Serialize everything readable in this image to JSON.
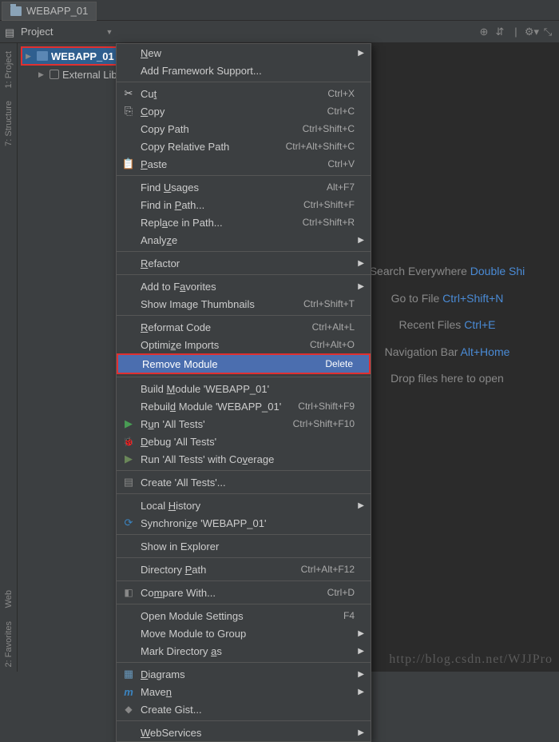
{
  "tab": {
    "title": "WEBAPP_01"
  },
  "toolbar": {
    "project_label": "Project"
  },
  "tree": {
    "module": "WEBAPP_01",
    "external": "External Librar"
  },
  "sidebar": {
    "project": "1: Project",
    "structure": "7: Structure",
    "web": "Web",
    "favorites": "2: Favorites"
  },
  "welcome": {
    "search_label": "Search Everywhere",
    "search_short": "Double Shi",
    "goto_label": "Go to File",
    "goto_short": "Ctrl+Shift+N",
    "recent_label": "Recent Files",
    "recent_short": "Ctrl+E",
    "nav_label": "Navigation Bar",
    "nav_short": "Alt+Home",
    "drop": "Drop files here to open"
  },
  "menu": {
    "new": "New",
    "add_framework": "Add Framework Support...",
    "cut": "Cut",
    "cut_s": "Ctrl+X",
    "copy": "Copy",
    "copy_s": "Ctrl+C",
    "copy_path": "Copy Path",
    "copy_path_s": "Ctrl+Shift+C",
    "copy_rel": "Copy Relative Path",
    "copy_rel_s": "Ctrl+Alt+Shift+C",
    "paste": "Paste",
    "paste_s": "Ctrl+V",
    "find_usages": "Find Usages",
    "find_usages_s": "Alt+F7",
    "find_in_path": "Find in Path...",
    "find_in_path_s": "Ctrl+Shift+F",
    "replace": "Replace in Path...",
    "replace_s": "Ctrl+Shift+R",
    "analyze": "Analyze",
    "refactor": "Refactor",
    "add_fav": "Add to Favorites",
    "show_thumb": "Show Image Thumbnails",
    "show_thumb_s": "Ctrl+Shift+T",
    "reformat": "Reformat Code",
    "reformat_s": "Ctrl+Alt+L",
    "optimize": "Optimize Imports",
    "optimize_s": "Ctrl+Alt+O",
    "remove": "Remove Module",
    "remove_s": "Delete",
    "build": "Build Module 'WEBAPP_01'",
    "rebuild": "Rebuild Module 'WEBAPP_01'",
    "rebuild_s": "Ctrl+Shift+F9",
    "run": "Run 'All Tests'",
    "run_s": "Ctrl+Shift+F10",
    "debug": "Debug 'All Tests'",
    "run_cov": "Run 'All Tests' with Coverage",
    "create_tests": "Create 'All Tests'...",
    "local_hist": "Local History",
    "sync": "Synchronize 'WEBAPP_01'",
    "show_expl": "Show in Explorer",
    "dir_path": "Directory Path",
    "dir_path_s": "Ctrl+Alt+F12",
    "compare": "Compare With...",
    "compare_s": "Ctrl+D",
    "open_mod": "Open Module Settings",
    "open_mod_s": "F4",
    "move_mod": "Move Module to Group",
    "mark_dir": "Mark Directory as",
    "diagrams": "Diagrams",
    "maven": "Maven",
    "gist": "Create Gist...",
    "webservices": "WebServices"
  },
  "watermark": "http://blog.csdn.net/WJJPro"
}
